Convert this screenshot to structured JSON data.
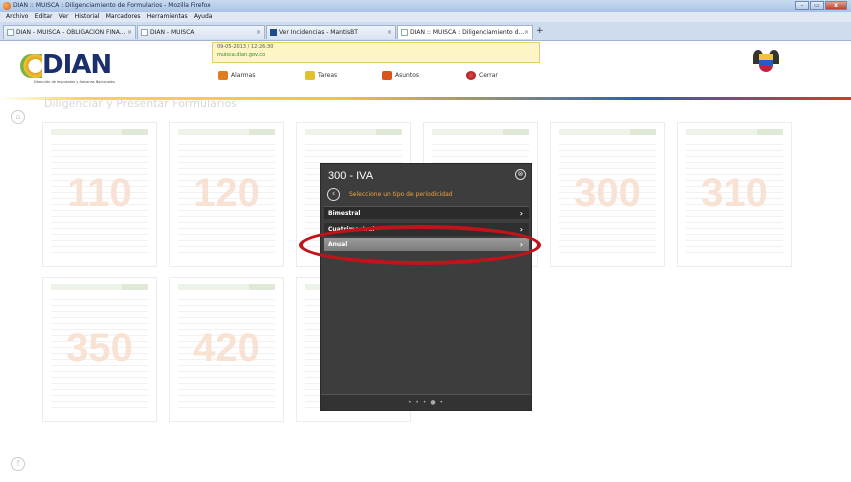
{
  "window": {
    "title": "DIAN :: MUISCA : Diligenciamiento de Formularios - Mozilla Firefox",
    "buttons": {
      "minimize": "–",
      "maximize": "▭",
      "close": "x"
    }
  },
  "menu": [
    "Archivo",
    "Editar",
    "Ver",
    "Historial",
    "Marcadores",
    "Herramientas",
    "Ayuda"
  ],
  "tabs": [
    {
      "label": "DIAN - MUISCA - OBLIGACION FINA...",
      "close": "×"
    },
    {
      "label": "DIAN - MUISCA",
      "close": "×"
    },
    {
      "label": "Ver Incidencias - MantisBT",
      "close": "×"
    },
    {
      "label": "DIAN :: MUISCA : Diligenciamiento d...",
      "close": "×"
    }
  ],
  "newtab": "+",
  "header": {
    "logo_text": "DIAN",
    "logo_sub": "Dirección de Impuestos y Aduanas Nacionales",
    "datetime": "09-05-2013 / 12:26:30",
    "url": "muisca.dian.gov.co",
    "nav": [
      {
        "label": "Alarmas",
        "color": "#e07b1e"
      },
      {
        "label": "Tareas",
        "color": "#e3c12a"
      },
      {
        "label": "Asuntos",
        "color": "#d9531e"
      },
      {
        "label": "Cerrar",
        "color": "#b3141a"
      }
    ]
  },
  "content": {
    "page_title": "Diligenciar y Presentar Formularios",
    "home_icon": "⌂",
    "fb_icon": "f",
    "cards": [
      "110",
      "120",
      "",
      "",
      "300",
      "310",
      "350",
      "420",
      ""
    ]
  },
  "modal": {
    "title": "300 - IVA",
    "close": "⊗",
    "back": "‹",
    "subtitle": "Seleccione un tipo de periodicidad",
    "options": [
      {
        "label": "Bimestral",
        "chev": "›"
      },
      {
        "label": "Cuatrimestral",
        "chev": "›"
      },
      {
        "label": "Anual",
        "chev": "›"
      }
    ],
    "pager": "• • • ● •"
  }
}
